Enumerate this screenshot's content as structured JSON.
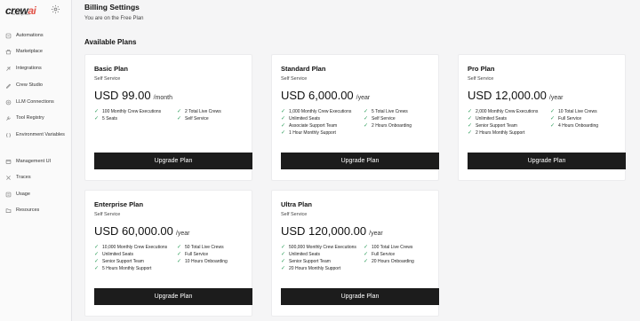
{
  "header": {
    "title": "Billing Settings",
    "current_plan": "You are on the Free Plan",
    "section": "Available Plans"
  },
  "logo": {
    "text": "crew",
    "accent": "ai",
    "sub": "enterprise"
  },
  "nav": [
    {
      "label": "Automations",
      "icon": "automations-icon"
    },
    {
      "label": "Marketplace",
      "icon": "marketplace-icon"
    },
    {
      "label": "Integrations",
      "icon": "integrations-icon"
    },
    {
      "label": "Crew Studio",
      "icon": "crew-studio-icon"
    },
    {
      "label": "LLM Connections",
      "icon": "llm-connections-icon"
    },
    {
      "label": "Tool Registry",
      "icon": "tool-registry-icon"
    },
    {
      "label": "Environment Variables",
      "icon": "environment-variables-icon"
    },
    {
      "label": "Management UI",
      "icon": "management-ui-icon"
    },
    {
      "label": "Traces",
      "icon": "traces-icon"
    },
    {
      "label": "Usage",
      "icon": "usage-icon"
    },
    {
      "label": "Resources",
      "icon": "resources-icon"
    }
  ],
  "plans": [
    {
      "name": "Basic Plan",
      "tier": "Self Service",
      "price": "USD 99.00",
      "period": "/month",
      "features": [
        "100 Monthly Crew Executions",
        "2 Total Live Crews",
        "5 Seats",
        "Self Service"
      ],
      "button": "Upgrade Plan"
    },
    {
      "name": "Standard Plan",
      "tier": "Self Service",
      "price": "USD 6,000.00",
      "period": "/year",
      "features": [
        "1,000 Monthly Crew Executions",
        "5 Total Live Crews",
        "Unlimited Seats",
        "Self Service",
        "Associate Support Team",
        "2 Hours Onboarding",
        "1 Hour Monthly Support"
      ],
      "button": "Upgrade Plan"
    },
    {
      "name": "Pro Plan",
      "tier": "Self Service",
      "price": "USD 12,000.00",
      "period": "/year",
      "features": [
        "2,000 Monthly Crew Executions",
        "10 Total Live Crews",
        "Unlimited Seats",
        "Full Service",
        "Senior Support Team",
        "4 Hours Onboarding",
        "2 Hours Monthly Support"
      ],
      "button": "Upgrade Plan"
    },
    {
      "name": "Enterprise Plan",
      "tier": "Self Service",
      "price": "USD 60,000.00",
      "period": "/year",
      "features": [
        "10,000 Monthly Crew Executions",
        "50 Total Live Crews",
        "Unlimited Seats",
        "Full Service",
        "Senior Support Team",
        "10 Hours Onboarding",
        "5 Hours Monthly Support"
      ],
      "button": "Upgrade Plan"
    },
    {
      "name": "Ultra Plan",
      "tier": "Self Service",
      "price": "USD 120,000.00",
      "period": "/year",
      "features": [
        "500,000 Monthly Crew Executions",
        "100 Total Live Crews",
        "Unlimited Seats",
        "Full Service",
        "Senior Support Team",
        "20 Hours Onboarding",
        "20 Hours Monthly Support"
      ],
      "button": "Upgrade Plan"
    }
  ],
  "colors": {
    "check": "#2f9e5b",
    "button_bg": "#1c1c1c",
    "logo_accent": "#e2574c"
  }
}
